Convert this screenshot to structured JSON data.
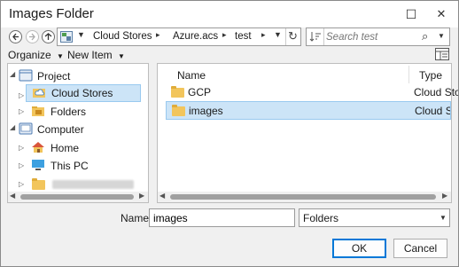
{
  "window": {
    "title": "Images Folder",
    "maximize_glyph": "☐",
    "close_glyph": "✕"
  },
  "address": {
    "crumbs": [
      "Cloud Stores",
      "Azure.acs",
      "test"
    ],
    "refresh_glyph": "↻"
  },
  "search": {
    "placeholder": "Search test",
    "icon_glyph": "⌕"
  },
  "toolbar": {
    "organize_label": "Organize",
    "new_item_label": "New Item"
  },
  "tree": {
    "items": [
      {
        "label": "Project",
        "icon": "project-icon"
      },
      {
        "label": "Cloud Stores",
        "icon": "cloud-stores-icon"
      },
      {
        "label": "Folders",
        "icon": "folders-icon"
      },
      {
        "label": "Computer",
        "icon": "computer-icon"
      },
      {
        "label": "Home",
        "icon": "home-icon"
      },
      {
        "label": "This PC",
        "icon": "this-pc-icon"
      },
      {
        "label": "",
        "icon": "folder-icon"
      }
    ]
  },
  "list": {
    "columns": {
      "name": "Name",
      "type": "Type"
    },
    "rows": [
      {
        "name": "GCP",
        "type": "Cloud Stores"
      },
      {
        "name": "images",
        "type": "Cloud Stores"
      }
    ]
  },
  "footer": {
    "name_label": "Name",
    "name_value": "images",
    "filter_value": "Folders",
    "ok_label": "OK",
    "cancel_label": "Cancel"
  },
  "colors": {
    "selection": "#cce4f7",
    "selection_border": "#99c9ef",
    "accent": "#0078d7",
    "folder": "#f2c55c"
  }
}
